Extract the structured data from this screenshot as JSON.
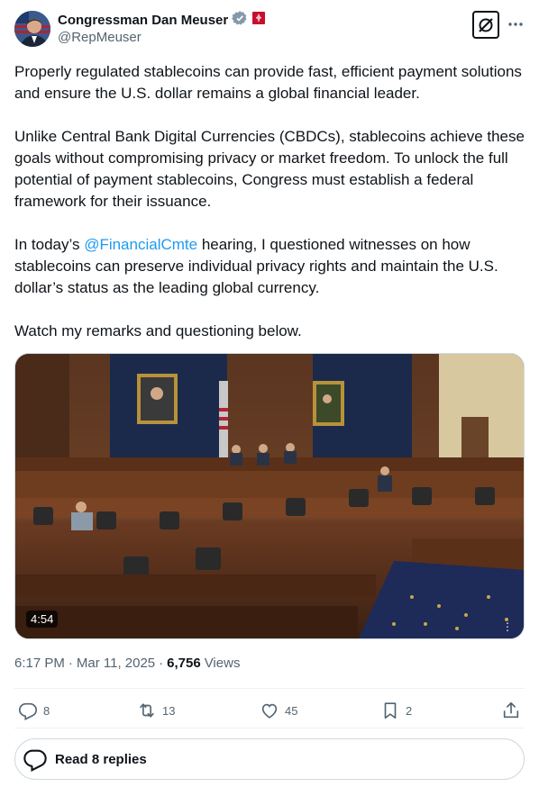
{
  "author": {
    "display_name": "Congressman Dan Meuser",
    "handle": "@RepMeuser",
    "verified_color": "#829aab",
    "badge_color": "#c8102e"
  },
  "tweet": {
    "para1": "Properly regulated stablecoins can provide fast, efficient payment solutions and ensure the U.S. dollar remains a global financial leader.",
    "para2": "Unlike Central Bank Digital Currencies (CBDCs), stablecoins achieve these goals without compromising privacy or market freedom. To unlock the full potential of payment stablecoins, Congress must establish a federal framework for their issuance.",
    "para3_before": "In today’s ",
    "para3_mention": "@FinancialCmte",
    "para3_after": " hearing, I questioned witnesses on how stablecoins can preserve individual privacy rights and maintain the U.S. dollar’s status as the leading global currency.",
    "para4": "Watch my remarks and questioning below."
  },
  "media": {
    "duration": "4:54",
    "more": "⋮"
  },
  "meta": {
    "time": "6:17 PM",
    "sep1": "·",
    "date": "Mar 11, 2025",
    "sep2": "·",
    "views_count": "6,756",
    "views_label": "Views"
  },
  "actions": {
    "replies": "8",
    "reposts": "13",
    "likes": "45",
    "bookmarks": "2"
  },
  "replies_button": {
    "label": "Read 8 replies"
  },
  "colors": {
    "accent": "#1d9bf0",
    "muted": "#536471",
    "text": "#0f1419"
  }
}
